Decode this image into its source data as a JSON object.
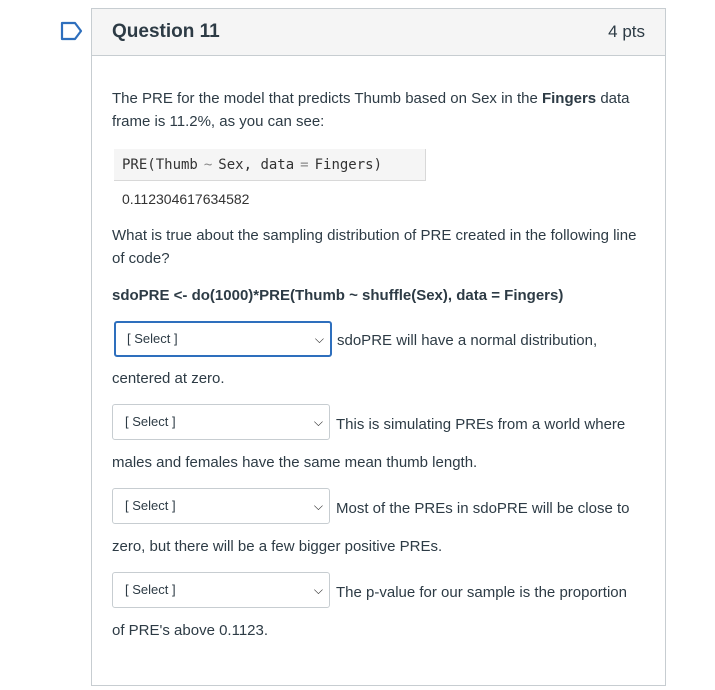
{
  "question": {
    "title": "Question 11",
    "points": "4 pts"
  },
  "intro": {
    "before": "The PRE for the model that predicts Thumb based on Sex in the ",
    "bold": "Fingers",
    "after": " data frame is 11.2%, as you can see:"
  },
  "code": {
    "fn_open": "PRE(Thumb",
    "tilde": "~",
    "mid": "Sex, data",
    "eq": "=",
    "close": "Fingers)",
    "output": "0.112304617634582"
  },
  "question_text": "What is true about the sampling distribution of PRE created in the following line of code?",
  "code_line": "sdoPRE <- do(1000)*PRE(Thumb ~ shuffle(Sex), data = Fingers)",
  "selects": [
    {
      "value": "[ Select ]",
      "statement": "sdoPRE will have a normal distribution,",
      "continuation": "centered at zero."
    },
    {
      "value": "[ Select ]",
      "statement": "This is simulating PREs from a world where",
      "continuation": "males and females have the same mean thumb length."
    },
    {
      "value": "[ Select ]",
      "statement": "Most of the PREs in sdoPRE will be close to",
      "continuation": "zero, but there will be a few bigger positive PREs."
    },
    {
      "value": "[ Select ]",
      "statement": "The p-value for our sample is the proportion",
      "continuation": "of PRE's above 0.1123."
    }
  ],
  "icons": {
    "flag": "bookmark-flag-icon",
    "chevron": "chevron-down-icon"
  },
  "colors": {
    "flag_blue": "#2e6fbd",
    "focus_border": "#2e6fbd",
    "text": "#2d3b45"
  }
}
